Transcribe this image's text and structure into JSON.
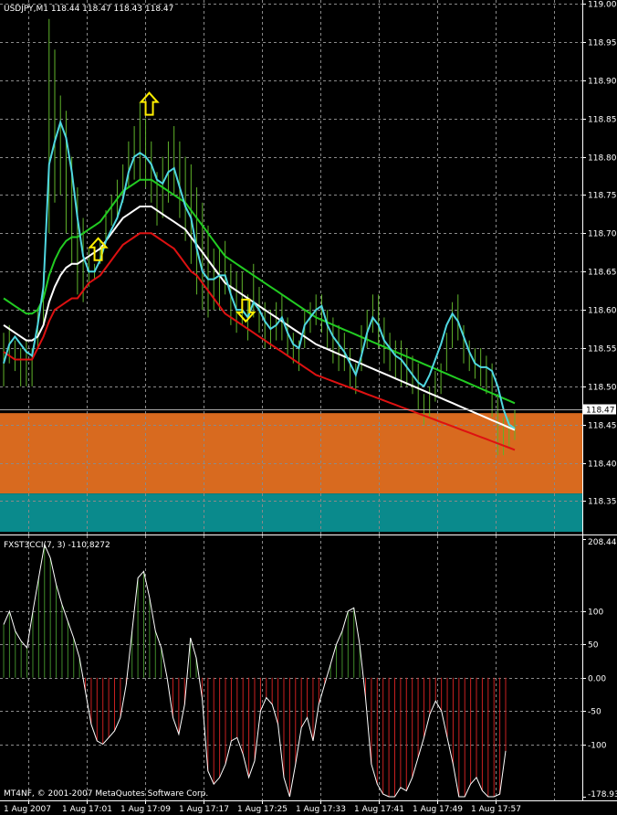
{
  "main_chart": {
    "header": "USDJPY,M1  118.44 118.47 118.43 118.47",
    "price_axis_labels": [
      "119.00",
      "118.95",
      "118.90",
      "118.85",
      "118.80",
      "118.75",
      "118.70",
      "118.65",
      "118.60",
      "118.55",
      "118.50",
      "118.45",
      "118.40",
      "118.35"
    ],
    "current_price_label": "118.47",
    "colors": {
      "background": "#000000",
      "grid": "#8a8a8a",
      "candles": "#5fb32a",
      "fast_line": "#4fd7e0",
      "upper_band": "#22cc22",
      "middle_band": "#ffffff",
      "lower_band": "#dd1111",
      "arrows": "#ffee00",
      "orange_zone": "#d86a1f",
      "teal_zone": "#0a8a8c"
    }
  },
  "indicator": {
    "header": "FXST3CCI(7, 3) -110.8272",
    "axis_labels": [
      "208.448",
      "100",
      "50",
      "0.00",
      "-50",
      "-100",
      "-178.934"
    ],
    "colors": {
      "positive": "#3f8a2a",
      "negative": "#c82020",
      "line": "#ffffff"
    }
  },
  "time_axis_labels": [
    "1 Aug 2007",
    "1 Aug 17:01",
    "1 Aug 17:09",
    "1 Aug 17:17",
    "1 Aug 17:25",
    "1 Aug 17:33",
    "1 Aug 17:41",
    "1 Aug 17:49",
    "1 Aug 17:57"
  ],
  "copyright": "MT4NF, © 2001-2007 MetaQuotes Software Corp.",
  "chart_data": [
    {
      "type": "line",
      "title": "USDJPY,M1  118.44 118.47 118.43 118.47",
      "xlabel": "",
      "ylabel": "",
      "ylim": [
        118.31,
        119.0
      ],
      "grid": true,
      "x": [
        0,
        1,
        2,
        3,
        4,
        5,
        6,
        7,
        8,
        9,
        10,
        11,
        12,
        13,
        14,
        15,
        16,
        17,
        18,
        19,
        20,
        21,
        22,
        23,
        24,
        25,
        26,
        27,
        28,
        29,
        30,
        31,
        32,
        33,
        34,
        35,
        36,
        37,
        38,
        39,
        40,
        41,
        42,
        43,
        44,
        45,
        46,
        47,
        48,
        49,
        50,
        51,
        52,
        53,
        54,
        55,
        56,
        57,
        58,
        59,
        60,
        61,
        62,
        63,
        64,
        65,
        66,
        67,
        68,
        69,
        70,
        71,
        72,
        73,
        74,
        75,
        76,
        77,
        78,
        79,
        80,
        81,
        82,
        83,
        84,
        85,
        86,
        87,
        88,
        89,
        90
      ],
      "x_tick_labels": [
        "1 Aug 2007",
        "1 Aug 17:01",
        "1 Aug 17:09",
        "1 Aug 17:17",
        "1 Aug 17:25",
        "1 Aug 17:33",
        "1 Aug 17:41",
        "1 Aug 17:49",
        "1 Aug 17:57"
      ],
      "bar_highs": [
        118.57,
        118.58,
        118.56,
        118.55,
        118.56,
        118.55,
        118.6,
        118.65,
        118.98,
        118.94,
        118.88,
        118.86,
        118.8,
        118.76,
        118.72,
        118.68,
        118.66,
        118.69,
        118.73,
        118.75,
        118.77,
        118.79,
        118.82,
        118.84,
        118.87,
        118.85,
        118.82,
        118.78,
        118.8,
        118.82,
        118.84,
        118.82,
        118.8,
        118.79,
        118.76,
        118.74,
        118.71,
        118.68,
        118.68,
        118.69,
        118.66,
        118.65,
        118.65,
        118.62,
        118.66,
        118.63,
        118.61,
        118.6,
        118.61,
        118.62,
        118.59,
        118.57,
        118.56,
        118.6,
        118.61,
        118.62,
        118.62,
        118.6,
        118.59,
        118.58,
        118.57,
        118.55,
        118.53,
        118.58,
        118.6,
        118.62,
        118.62,
        118.59,
        118.57,
        118.56,
        118.56,
        118.55,
        118.54,
        118.53,
        118.49,
        118.5,
        118.52,
        118.53,
        118.57,
        118.61,
        118.62,
        118.58,
        118.56,
        118.55,
        118.55,
        118.54,
        118.53,
        118.49,
        118.46,
        118.46,
        118.47
      ],
      "bar_lows": [
        118.5,
        118.53,
        118.52,
        118.5,
        118.5,
        118.5,
        118.55,
        118.58,
        118.7,
        118.74,
        118.75,
        118.7,
        118.66,
        118.62,
        118.61,
        118.63,
        118.64,
        118.66,
        118.69,
        118.71,
        118.72,
        118.74,
        118.76,
        118.77,
        118.77,
        118.76,
        118.74,
        118.71,
        118.72,
        118.74,
        118.75,
        118.72,
        118.69,
        118.66,
        118.62,
        118.6,
        118.59,
        118.6,
        118.6,
        118.62,
        118.58,
        118.57,
        118.58,
        118.56,
        118.59,
        118.57,
        118.55,
        118.55,
        118.56,
        118.56,
        118.54,
        118.53,
        118.52,
        118.55,
        118.57,
        118.58,
        118.57,
        118.55,
        118.53,
        118.52,
        118.52,
        118.5,
        118.49,
        118.52,
        118.55,
        118.57,
        118.55,
        118.53,
        118.52,
        118.51,
        118.5,
        118.5,
        118.49,
        118.47,
        118.45,
        118.46,
        118.48,
        118.49,
        118.52,
        118.55,
        118.56,
        118.53,
        118.52,
        118.51,
        118.5,
        118.49,
        118.46,
        118.41,
        118.41,
        118.42,
        118.43
      ],
      "series": [
        {
          "values": [
            118.53,
            118.555,
            118.565,
            118.555,
            118.545,
            118.54,
            118.58,
            118.63,
            118.79,
            118.82,
            118.845,
            118.825,
            118.78,
            118.72,
            118.67,
            118.65,
            118.65,
            118.665,
            118.69,
            118.705,
            118.72,
            118.745,
            118.78,
            118.8,
            118.805,
            118.8,
            118.79,
            118.77,
            118.765,
            118.78,
            118.785,
            118.76,
            118.735,
            118.72,
            118.68,
            118.65,
            118.64,
            118.64,
            118.645,
            118.645,
            118.62,
            118.6,
            118.6,
            118.59,
            118.61,
            118.6,
            118.585,
            118.575,
            118.58,
            118.59,
            118.57,
            118.555,
            118.55,
            118.58,
            118.59,
            118.6,
            118.605,
            118.58,
            118.565,
            118.555,
            118.545,
            118.53,
            118.515,
            118.54,
            118.57,
            118.59,
            118.58,
            118.56,
            118.55,
            118.54,
            118.535,
            118.525,
            118.515,
            118.505,
            118.5,
            118.515,
            118.535,
            118.555,
            118.58,
            118.595,
            118.585,
            118.565,
            118.545,
            118.53,
            118.525,
            118.525,
            118.52,
            118.5,
            118.47,
            118.45,
            118.445
          ]
        },
        {
          "values": [
            118.61,
            118.605,
            118.6,
            118.595,
            118.59,
            118.585,
            118.59,
            118.605,
            118.64,
            118.66,
            118.675,
            118.685,
            118.69,
            118.69,
            118.695,
            118.7,
            118.705,
            118.71,
            118.72,
            118.73,
            118.74,
            118.75,
            118.755,
            118.76,
            118.765,
            118.77,
            118.77,
            118.765,
            118.76,
            118.755,
            118.75,
            118.745,
            118.74,
            118.73,
            118.72,
            118.71,
            118.7,
            118.69,
            118.68,
            118.67,
            118.665,
            118.66,
            118.655,
            118.65,
            118.645,
            118.64,
            118.635,
            118.63,
            118.625,
            118.62,
            118.615,
            118.61,
            118.605,
            118.6,
            118.6,
            118.6,
            118.6,
            118.6,
            118.6,
            118.6,
            118.6,
            118.6,
            118.6,
            118.6,
            118.6,
            118.6,
            118.6,
            118.6,
            118.6,
            118.6,
            118.6,
            118.6,
            118.6,
            118.6,
            118.6,
            118.6,
            118.6,
            118.6,
            118.6,
            118.6,
            118.6,
            118.6,
            118.6,
            118.6,
            118.6,
            118.6,
            118.6,
            118.6,
            118.6,
            118.6,
            118.6
          ]
        },
        {
          "values": [
            118.58,
            118.575,
            118.57,
            118.565,
            118.56,
            118.56,
            118.565,
            118.58,
            118.61,
            118.63,
            118.645,
            118.655,
            118.66,
            118.66,
            118.665,
            118.67,
            118.675,
            118.68,
            118.69,
            118.7,
            118.71,
            118.72,
            118.725,
            118.73,
            118.735,
            118.735,
            118.735,
            118.73,
            118.725,
            118.72,
            118.715,
            118.71,
            118.705,
            118.695,
            118.685,
            118.675,
            118.665,
            118.655,
            118.645,
            118.635,
            118.63,
            118.625,
            118.62,
            118.615,
            118.61,
            118.605,
            118.6,
            118.595,
            118.59,
            118.585,
            118.58,
            118.575,
            118.57,
            118.565,
            118.56,
            118.555,
            118.55,
            118.545,
            118.54,
            118.535,
            118.53,
            118.525,
            118.52,
            118.515,
            118.51,
            118.505,
            118.5,
            118.495,
            118.49,
            118.485,
            118.48,
            118.475,
            118.47,
            118.465,
            118.46,
            118.455,
            118.45,
            118.445,
            118.44,
            118.435,
            118.43,
            118.425,
            118.42,
            118.415,
            118.41,
            118.405,
            118.4,
            118.395,
            118.39,
            118.385,
            118.38
          ]
        },
        {
          "values": [
            118.545,
            118.54,
            118.535,
            118.535,
            118.535,
            118.535,
            118.55,
            118.565,
            118.585,
            118.6,
            118.605,
            118.61,
            118.615,
            118.615,
            118.625,
            118.635,
            118.64,
            118.645,
            118.655,
            118.665,
            118.675,
            118.685,
            118.69,
            118.695,
            118.7,
            118.7,
            118.7,
            118.695,
            118.69,
            118.685,
            118.68,
            118.67,
            118.66,
            118.65,
            118.645,
            118.635,
            118.625,
            118.615,
            118.605,
            118.595,
            118.59,
            118.585,
            118.58,
            118.575,
            118.57,
            118.565,
            118.56,
            118.555,
            118.55,
            118.545,
            118.54,
            118.535,
            118.53,
            118.525,
            118.52,
            118.515,
            118.51,
            118.505,
            118.5,
            118.495,
            118.49,
            118.485,
            118.48,
            118.475,
            118.47,
            118.465,
            118.46,
            118.455,
            118.45,
            118.445,
            118.44,
            118.435,
            118.43,
            118.425,
            118.42,
            118.415,
            118.41,
            118.405,
            118.4,
            118.395,
            118.39,
            118.385,
            118.38,
            118.375,
            118.37,
            118.365,
            118.36,
            118.355,
            118.35,
            118.345,
            118.34
          ]
        }
      ],
      "zones": [
        {
          "from": 118.36,
          "to": 118.465
        },
        {
          "from": 118.31,
          "to": 118.36
        }
      ],
      "arrows": [
        {
          "x": 16,
          "direction": "up"
        },
        {
          "x": 25,
          "direction": "up"
        },
        {
          "x": 42,
          "direction": "down"
        }
      ]
    },
    {
      "type": "bar",
      "title": "FXST3CCI(7, 3) -110.8272",
      "xlabel": "",
      "ylabel": "",
      "ylim": [
        -178.934,
        208.448
      ],
      "grid": true,
      "values": [
        80,
        100,
        70,
        55,
        45,
        100,
        150,
        200,
        180,
        140,
        110,
        85,
        60,
        30,
        -20,
        -70,
        -95,
        -100,
        -90,
        -80,
        -60,
        -10,
        70,
        150,
        160,
        120,
        70,
        45,
        0,
        -60,
        -85,
        -40,
        60,
        30,
        -30,
        -140,
        -160,
        -150,
        -130,
        -95,
        -90,
        -115,
        -150,
        -125,
        -50,
        -30,
        -40,
        -70,
        -150,
        -180,
        -130,
        -75,
        -60,
        -95,
        -40,
        -10,
        20,
        50,
        70,
        100,
        105,
        50,
        -30,
        -130,
        -160,
        -175,
        -195,
        -180,
        -165,
        -170,
        -150,
        -120,
        -90,
        -55,
        -35,
        -50,
        -90,
        -130,
        -190,
        -180,
        -160,
        -150,
        -170,
        -210,
        -225,
        -175,
        -110
      ]
    }
  ]
}
